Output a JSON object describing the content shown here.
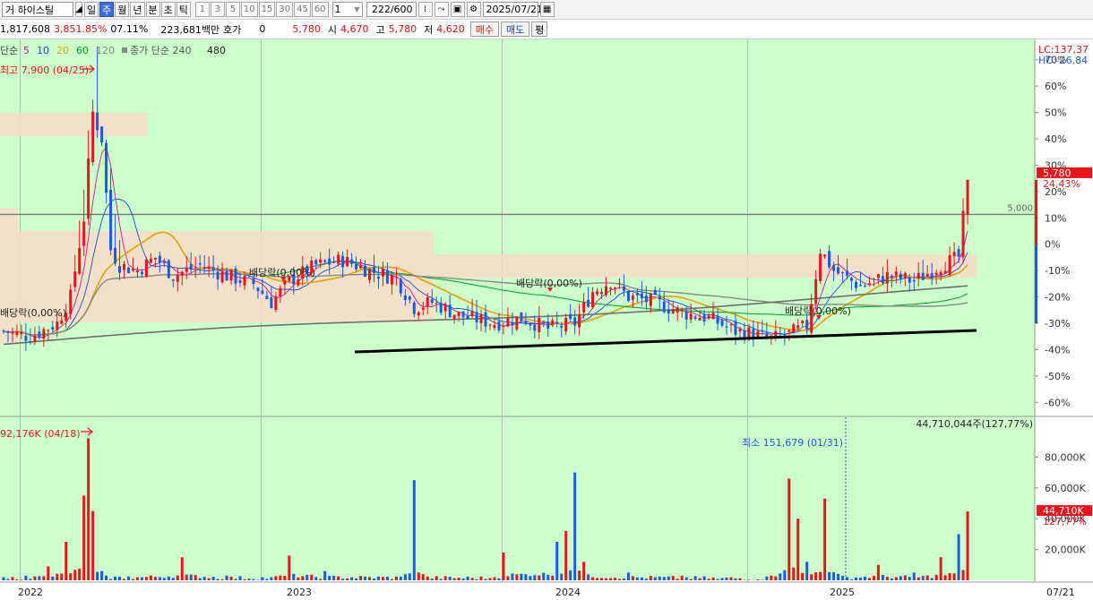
{
  "toolbar": {
    "stock_code_suffix": "거",
    "stock_name": "하이스틸",
    "periods": [
      "일",
      "주",
      "월",
      "년",
      "분",
      "초",
      "틱"
    ],
    "active_period": "주",
    "intervals": [
      "1",
      "3",
      "5",
      "10",
      "15",
      "30",
      "45",
      "60"
    ],
    "interval_value": "1",
    "bar_count": "222",
    "bar_total": "/600",
    "date": "2025/07/21"
  },
  "infobar": {
    "volume_val": "1,817,608",
    "volume_pct": "3,851.85%",
    "turnover": "07.11%",
    "amount": "223,681백만",
    "quote_label": "호가",
    "quote_val": "0",
    "price": "5,780",
    "open_label": "시",
    "open": "4,670",
    "high_label": "고",
    "high": "5,780",
    "low_label": "저",
    "low": "4,620",
    "buy_btn": "매수",
    "sell_btn": "매도",
    "eval_btn": "평"
  },
  "colors": {
    "up": "#e8141c",
    "down": "#1c5be0",
    "bg": "#ccffcc",
    "ma5": "#d8149a",
    "ma10": "#1848d8",
    "ma20": "#e8a000",
    "ma60": "#00a020",
    "ma120": "#888888",
    "ma240": "#707070"
  },
  "chart_data": {
    "type": "candlestick",
    "ma_legend": {
      "prefix": "단순",
      "items": [
        {
          "label": "5",
          "color": "#d8149a"
        },
        {
          "label": "10",
          "color": "#1848d8"
        },
        {
          "label": "20",
          "color": "#e8a000"
        },
        {
          "label": "60",
          "color": "#00a020"
        },
        {
          "label": "120",
          "color": "#888888"
        }
      ],
      "extra": "종가 단순 240",
      "extra2": "480"
    },
    "lc_label": "LC:137,37",
    "hc_label": "HC:-26,84",
    "high_annotation": "최고 7,900 (04/25)",
    "price_axis_ticks": [
      "70%",
      "60%",
      "50%",
      "40%",
      "30%",
      "20%",
      "10%",
      "0%",
      "-10%",
      "-20%",
      "-30%",
      "-40%",
      "-50%",
      "-60%"
    ],
    "price_axis_range_pct": [
      -65,
      75
    ],
    "current_price_label": "5,780",
    "current_pct_label": "24,43%",
    "ref_line_label": "5,000",
    "dividend_labels": [
      {
        "text": "배당락(0,00%)",
        "x_index": 0
      },
      {
        "text": "배당락(0,00%)",
        "x_index": 58
      },
      {
        "text": "배당락(0,00%)",
        "x_index": 113
      },
      {
        "text": "배당락(0,00%)",
        "x_index": 168
      }
    ],
    "x_axis_labels": [
      "2022",
      "2023",
      "2024",
      "2025",
      "07/21"
    ],
    "volume_max_annotation": "92,176K (04/18)",
    "volume_min_annotation": "최소 151,679 (01/31)",
    "volume_top_label": "44,710,044주(127,77%)",
    "volume_axis_ticks": [
      "80,000K",
      "60,000K",
      "40,000K",
      "20,000K"
    ],
    "volume_current_label": "44,710K",
    "volume_current_pct": "127,77%",
    "weeks": 188,
    "price_anchors": [
      [
        0,
        -33
      ],
      [
        6,
        -35
      ],
      [
        12,
        -30
      ],
      [
        15,
        -20
      ],
      [
        18,
        10
      ],
      [
        20,
        50
      ],
      [
        22,
        40
      ],
      [
        24,
        -2
      ],
      [
        26,
        -8
      ],
      [
        30,
        -10
      ],
      [
        34,
        -5
      ],
      [
        38,
        -12
      ],
      [
        44,
        -8
      ],
      [
        50,
        -12
      ],
      [
        56,
        -15
      ],
      [
        60,
        -22
      ],
      [
        64,
        -14
      ],
      [
        70,
        -8
      ],
      [
        76,
        -6
      ],
      [
        82,
        -10
      ],
      [
        88,
        -13
      ],
      [
        92,
        -24
      ],
      [
        96,
        -22
      ],
      [
        102,
        -27
      ],
      [
        110,
        -30
      ],
      [
        116,
        -28
      ],
      [
        122,
        -32
      ],
      [
        128,
        -30
      ],
      [
        132,
        -18
      ],
      [
        136,
        -14
      ],
      [
        140,
        -20
      ],
      [
        146,
        -22
      ],
      [
        152,
        -26
      ],
      [
        158,
        -28
      ],
      [
        164,
        -33
      ],
      [
        168,
        -34
      ],
      [
        172,
        -36
      ],
      [
        176,
        -34
      ],
      [
        180,
        -31
      ],
      [
        183,
        -2
      ],
      [
        186,
        -10
      ],
      [
        192,
        -16
      ],
      [
        198,
        -12
      ],
      [
        204,
        -14
      ],
      [
        210,
        -8
      ],
      [
        214,
        -5
      ],
      [
        216,
        24.4
      ]
    ],
    "volume_anchors_k": [
      [
        0,
        2000
      ],
      [
        5,
        3000
      ],
      [
        10,
        9000
      ],
      [
        14,
        25000
      ],
      [
        18,
        55000
      ],
      [
        19,
        92176
      ],
      [
        20,
        45000
      ],
      [
        22,
        6000
      ],
      [
        28,
        2500
      ],
      [
        40,
        15000
      ],
      [
        50,
        3000
      ],
      [
        60,
        2000
      ],
      [
        64,
        16000
      ],
      [
        72,
        6000
      ],
      [
        90,
        4000
      ],
      [
        92,
        65000
      ],
      [
        94,
        4000
      ],
      [
        110,
        2000
      ],
      [
        112,
        18000
      ],
      [
        124,
        25000
      ],
      [
        126,
        32000
      ],
      [
        128,
        70000
      ],
      [
        130,
        12000
      ],
      [
        140,
        5000
      ],
      [
        152,
        3000
      ],
      [
        160,
        800
      ],
      [
        168,
        152
      ],
      [
        172,
        3000
      ],
      [
        176,
        66000
      ],
      [
        178,
        40000
      ],
      [
        180,
        12000
      ],
      [
        184,
        53000
      ],
      [
        188,
        3000
      ],
      [
        196,
        10000
      ],
      [
        204,
        5000
      ],
      [
        210,
        15000
      ],
      [
        214,
        30000
      ],
      [
        216,
        44710
      ]
    ]
  }
}
